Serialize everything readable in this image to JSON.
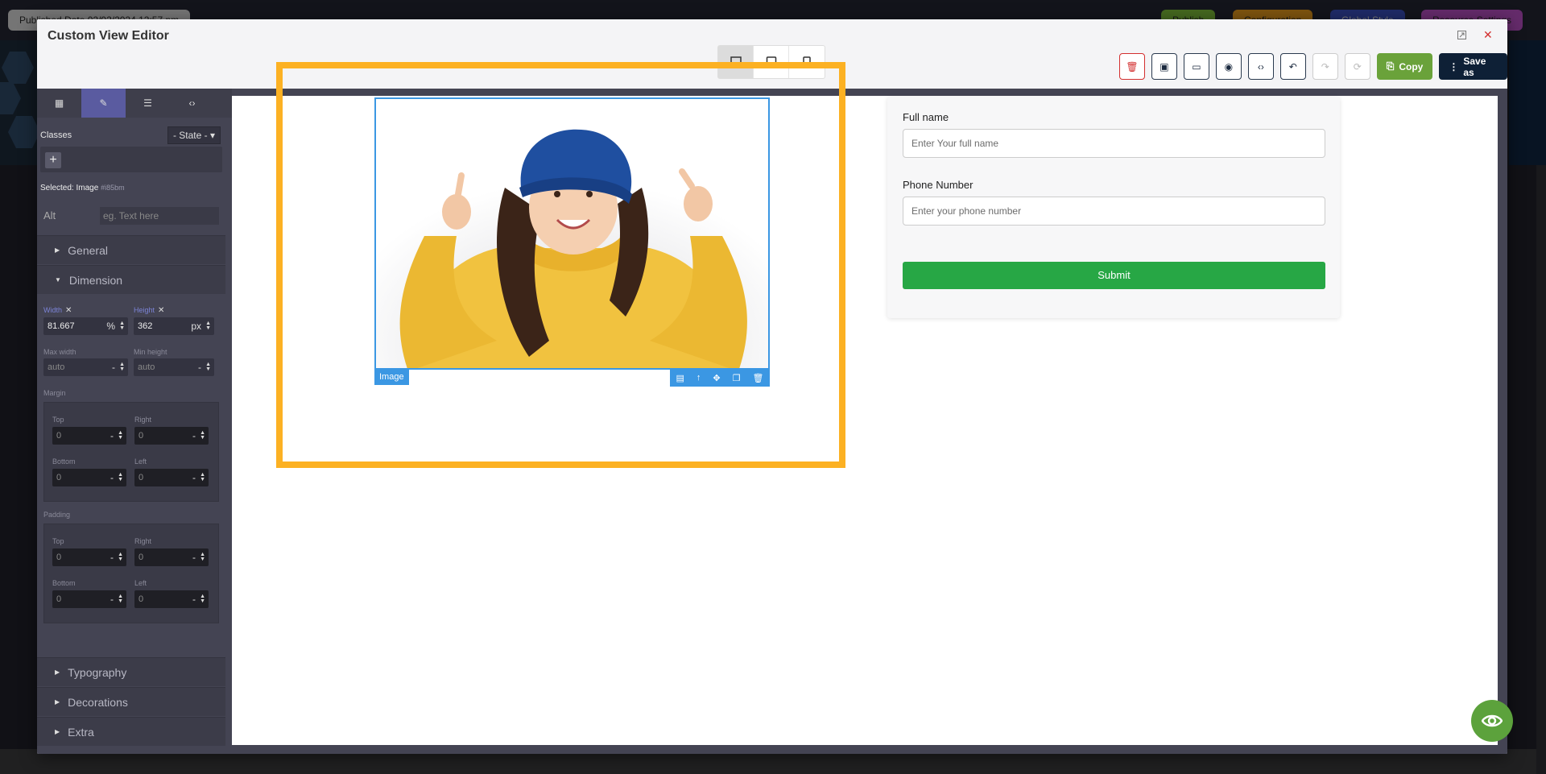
{
  "background": {
    "pills": [
      {
        "label": "Published Date 02/02/2024 12:57 pm",
        "color": "#d6d6d6"
      },
      {
        "label": "Publish",
        "color": "#7fbd3a"
      },
      {
        "label": "Configuration",
        "color": "#e69a1d"
      },
      {
        "label": "Global Style",
        "color": "#3a4fbd"
      },
      {
        "label": "Resource Settings",
        "color": "#b94fc4"
      }
    ]
  },
  "modal": {
    "title": "Custom View Editor",
    "header_icons": [
      "expand-icon",
      "close-icon"
    ],
    "devices": [
      {
        "name": "desktop",
        "icon": "desktop-icon",
        "active": true
      },
      {
        "name": "tablet",
        "icon": "tablet-icon",
        "active": false
      },
      {
        "name": "mobile",
        "icon": "mobile-icon",
        "active": false
      }
    ],
    "toolbar": {
      "copy_label": "Copy",
      "save_as_label": "Save as"
    }
  },
  "panel": {
    "tabs": [
      "blocks",
      "style-manager",
      "layer-manager",
      "code"
    ],
    "classes_label": "Classes",
    "state_label": "- State -",
    "add_tag": "+",
    "selected_prefix": "Selected:",
    "selected_name": "Image",
    "selected_id": "#i85bm",
    "alt_label": "Alt",
    "alt_placeholder": "eg. Text here",
    "sectors": {
      "general": "General",
      "dimension": "Dimension",
      "typography": "Typography",
      "decorations": "Decorations",
      "extra": "Extra"
    },
    "dimension": {
      "width_label": "Width",
      "width_value": "81.667",
      "width_unit": "%",
      "height_label": "Height",
      "height_value": "362",
      "height_unit": "px",
      "max_width_label": "Max width",
      "max_width_value": "auto",
      "max_width_unit": "-",
      "min_height_label": "Min height",
      "min_height_value": "auto",
      "min_height_unit": "-",
      "margin_label": "Margin",
      "padding_label": "Padding",
      "top_label": "Top",
      "right_label": "Right",
      "bottom_label": "Bottom",
      "left_label": "Left",
      "zero": "0",
      "dash": "-"
    }
  },
  "canvas": {
    "image_badge": "Image",
    "image_toolbar_icons": [
      "save-icon",
      "arrow-up-icon",
      "move-icon",
      "clone-icon",
      "trash-icon"
    ],
    "form": {
      "name_label": "Full name",
      "name_placeholder": "Enter Your full name",
      "phone_label": "Phone Number",
      "phone_placeholder": "Enter your phone number",
      "submit_label": "Submit"
    }
  },
  "colors": {
    "accent_highlight": "#fcb123",
    "selection_blue": "#3b97e3",
    "submit_green": "#27a745",
    "copy_green": "#6aa23a",
    "save_navy": "#0e2036"
  }
}
